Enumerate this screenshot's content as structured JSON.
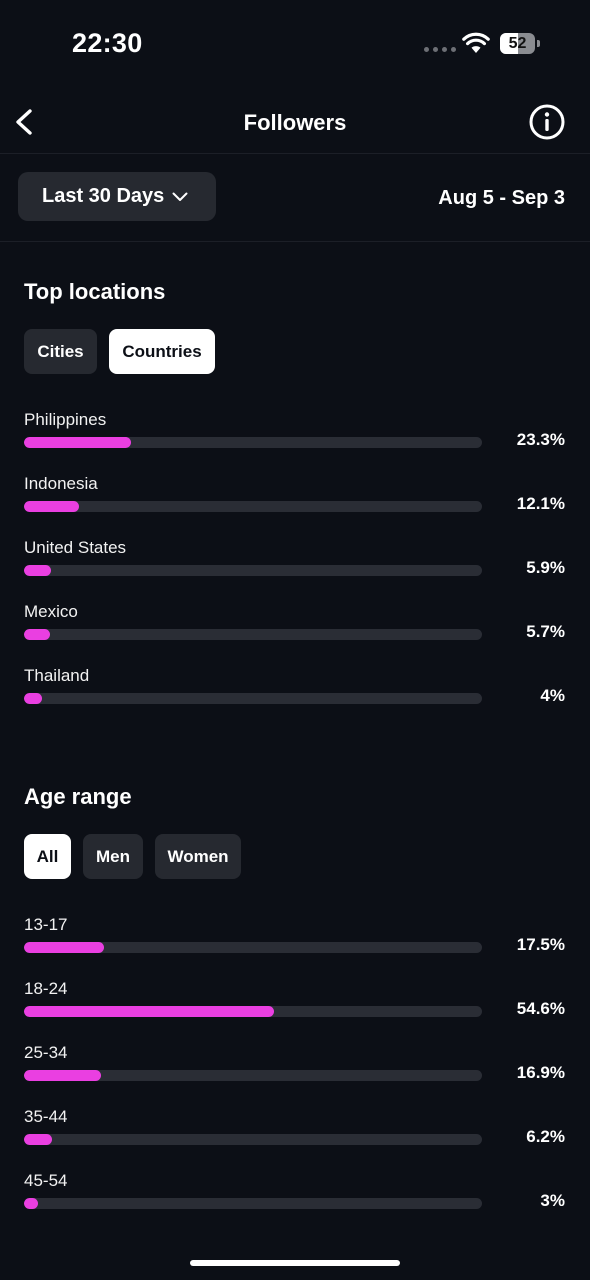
{
  "status": {
    "time": "22:30",
    "battery": "52"
  },
  "nav": {
    "title": "Followers"
  },
  "filter": {
    "range_label": "Last 30 Days",
    "dates": "Aug 5 - Sep 3"
  },
  "locations": {
    "title": "Top locations",
    "tabs": [
      {
        "label": "Cities",
        "active": false
      },
      {
        "label": "Countries",
        "active": true
      }
    ],
    "rows": [
      {
        "label": "Philippines",
        "value": "23.3%",
        "pct": 23.3
      },
      {
        "label": "Indonesia",
        "value": "12.1%",
        "pct": 12.1
      },
      {
        "label": "United States",
        "value": "5.9%",
        "pct": 5.9
      },
      {
        "label": "Mexico",
        "value": "5.7%",
        "pct": 5.7
      },
      {
        "label": "Thailand",
        "value": "4%",
        "pct": 4
      }
    ]
  },
  "age": {
    "title": "Age range",
    "tabs": [
      {
        "label": "All",
        "active": true
      },
      {
        "label": "Men",
        "active": false
      },
      {
        "label": "Women",
        "active": false
      }
    ],
    "rows": [
      {
        "label": "13-17",
        "value": "17.5%",
        "pct": 17.5
      },
      {
        "label": "18-24",
        "value": "54.6%",
        "pct": 54.6
      },
      {
        "label": "25-34",
        "value": "16.9%",
        "pct": 16.9
      },
      {
        "label": "35-44",
        "value": "6.2%",
        "pct": 6.2
      },
      {
        "label": "45-54",
        "value": "3%",
        "pct": 3
      }
    ]
  },
  "colors": {
    "accent": "#ea3fe1",
    "background": "#0c0f16",
    "track": "#2a2d35"
  }
}
